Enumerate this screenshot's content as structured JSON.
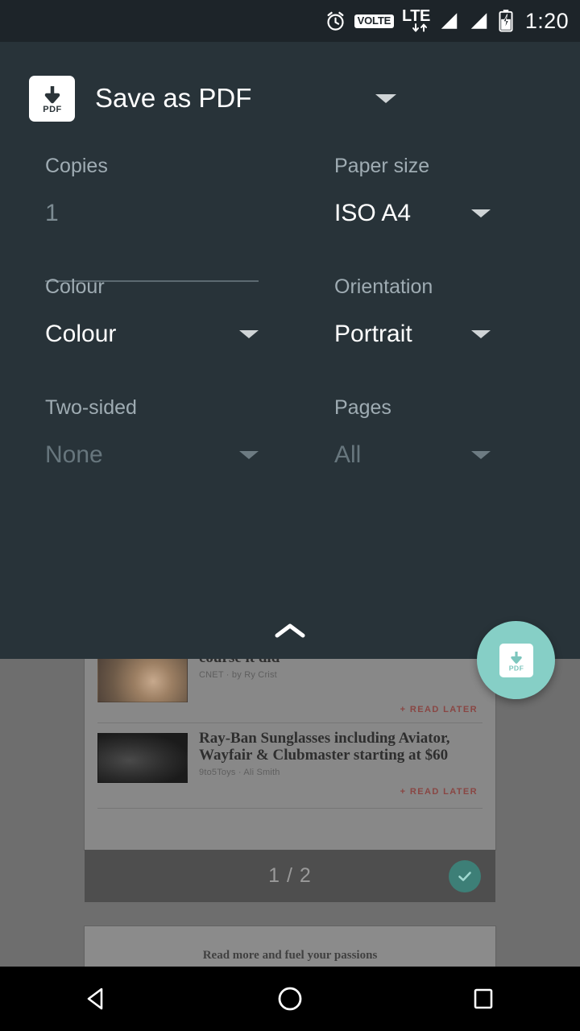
{
  "status_bar": {
    "alarm_icon": "alarm-clock-icon",
    "volte_label": "VOLTE",
    "lte_label": "LTE",
    "signal_icon_1": "signal-bars-icon",
    "signal_icon_2": "signal-bars-icon",
    "battery_icon": "battery-charging-icon",
    "time": "1:20"
  },
  "print_dialog": {
    "printer": {
      "icon": "save-as-pdf-icon",
      "name": "Save as PDF",
      "dropdown_icon": "chevron-down-icon"
    },
    "options": [
      {
        "label": "Copies",
        "value": "1",
        "state": "placeholder",
        "control": "text-field"
      },
      {
        "label": "Paper size",
        "value": "ISO A4",
        "state": "enabled",
        "control": "dropdown"
      },
      {
        "label": "Colour",
        "value": "Colour",
        "state": "enabled",
        "control": "dropdown"
      },
      {
        "label": "Orientation",
        "value": "Portrait",
        "state": "enabled",
        "control": "dropdown"
      },
      {
        "label": "Two-sided",
        "value": "None",
        "state": "disabled",
        "control": "dropdown"
      },
      {
        "label": "Pages",
        "value": "All",
        "state": "disabled",
        "control": "dropdown"
      }
    ],
    "collapse_icon": "chevron-up-icon"
  },
  "fab": {
    "icon": "save-as-pdf-icon",
    "label": "PDF"
  },
  "pdf_glyph_label": "PDF",
  "preview": {
    "articles": [
      {
        "title": "course it did",
        "source": "CNET · by Ry Crist",
        "action": "+ READ LATER",
        "thumbnail": "doorbell-photo"
      },
      {
        "title": "Ray-Ban Sunglasses including Aviator, Wayfair & Clubmaster starting at $60",
        "source": "9to5Toys · Ali Smith",
        "action": "+ READ LATER",
        "thumbnail": "sunglasses-photo"
      }
    ],
    "page_indicator": "1 / 2",
    "page_check_icon": "check-circle-icon",
    "footer_text": "Read more and fuel your passions"
  },
  "nav_bar": {
    "back_icon": "back-triangle-icon",
    "home_icon": "home-circle-icon",
    "recents_icon": "recents-square-icon"
  },
  "colors": {
    "panel_background": "#283339",
    "status_bar_background": "#1d2429",
    "accent_teal": "#86cfc6",
    "label_gray": "#9facb3",
    "read_later_red": "#8a3b38"
  }
}
